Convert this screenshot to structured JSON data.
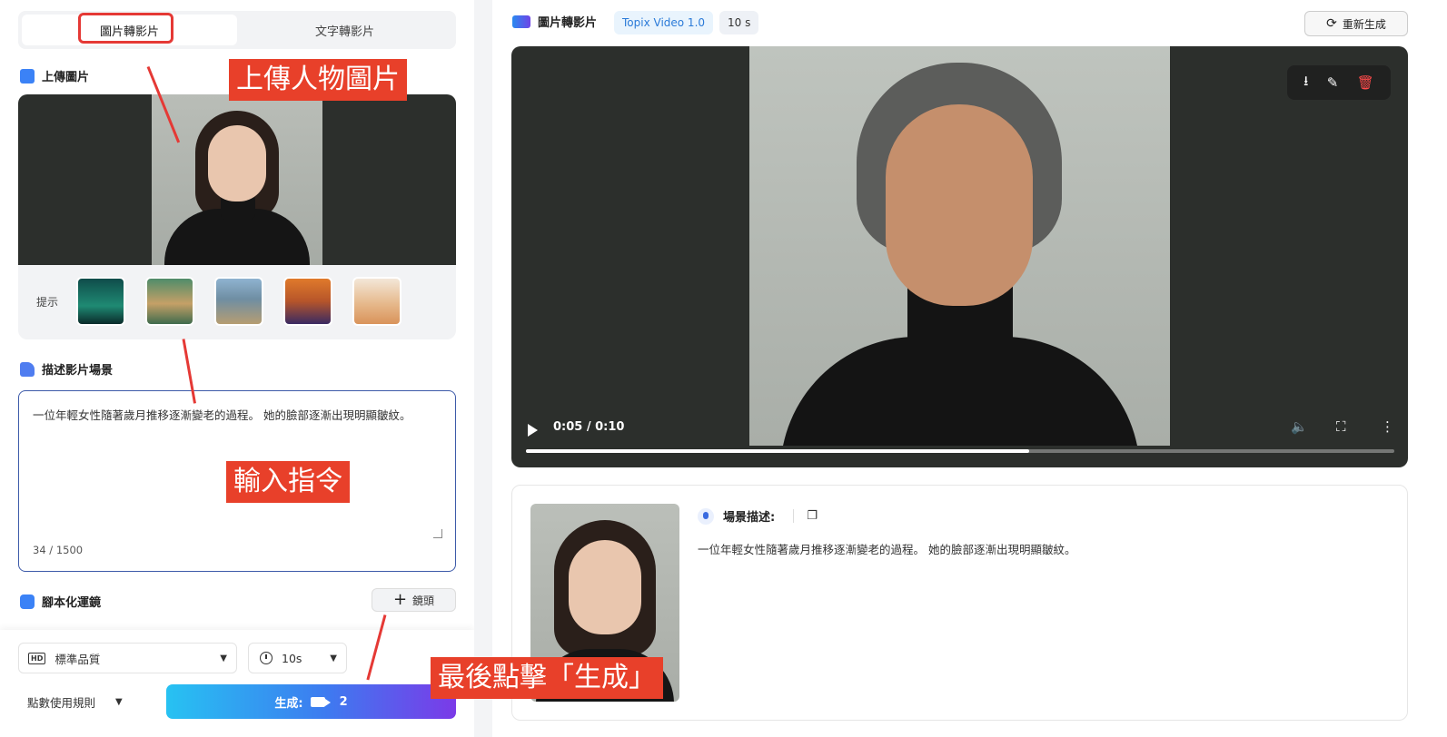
{
  "left": {
    "tabs": [
      "圖片轉影片",
      "文字轉影片"
    ],
    "upload_title": "上傳圖片",
    "hint_label": "提示",
    "hint_thumbs": [
      {
        "name": "aurora-thumb",
        "color": "#1f8a73"
      },
      {
        "name": "teddy-thumb",
        "color": "#c5a067"
      },
      {
        "name": "cyclist-thumb",
        "color": "#6f8ea3"
      },
      {
        "name": "perfume-thumb",
        "color": "#b6552a"
      },
      {
        "name": "cat-thumb",
        "color": "#e6b98c"
      }
    ],
    "describe_title": "描述影片場景",
    "description": "一位年輕女性隨著歲月推移逐漸變老的過程。 她的臉部逐漸出現明顯皺紋。",
    "char_count": "34 / 1500",
    "camera_title": "腳本化運鏡",
    "camera_button": "鏡頭",
    "quality_select": "標準品質",
    "quality_icon": "HD",
    "duration_select": "10s",
    "rules_label": "點數使用規則",
    "generate_label": "生成:",
    "generate_cost": "2"
  },
  "annotations": {
    "upload": "上傳人物圖片",
    "prompt": "輸入指令",
    "generate": "最後點擊「生成」"
  },
  "right": {
    "title": "圖片轉影片",
    "model": "Topix Video 1.0",
    "duration": "10 s",
    "regenerate": "重新生成",
    "video": {
      "time": "0:05 / 0:10",
      "progress": 0.58
    },
    "scene": {
      "title": "場景描述:",
      "text": "一位年輕女性隨著歲月推移逐漸變老的過程。 她的臉部逐漸出現明顯皺紋。"
    }
  },
  "colors": {
    "accent_blue": "#3d5aa9",
    "highlight_red": "#e53935",
    "annotation_bg": "#e8402a"
  }
}
